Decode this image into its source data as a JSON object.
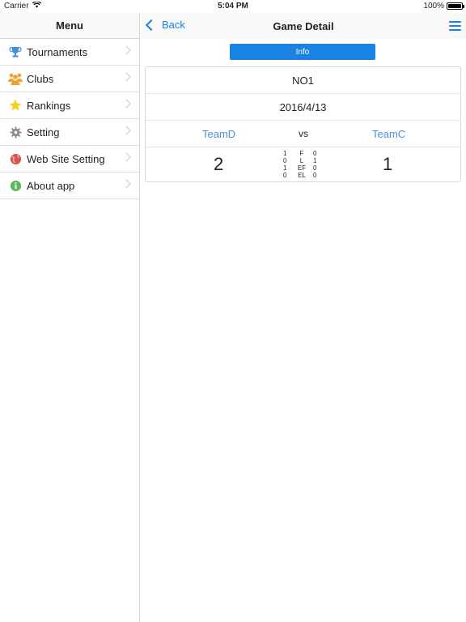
{
  "status_bar": {
    "carrier": "Carrier",
    "time": "5:04 PM",
    "battery": "100%"
  },
  "sidebar": {
    "title": "Menu",
    "items": [
      {
        "label": "Tournaments",
        "icon": "trophy-icon",
        "color": "#3d8fe0"
      },
      {
        "label": "Clubs",
        "icon": "people-icon",
        "color": "#f0a030"
      },
      {
        "label": "Rankings",
        "icon": "star-icon",
        "color": "#f2d21b"
      },
      {
        "label": "Setting",
        "icon": "gear-icon",
        "color": "#888888"
      },
      {
        "label": "Web Site Setting",
        "icon": "globe-icon",
        "color": "#d9534f"
      },
      {
        "label": "About app",
        "icon": "info-icon",
        "color": "#5cb85c"
      }
    ]
  },
  "navbar": {
    "back_label": "Back",
    "title": "Game Detail"
  },
  "tabs": {
    "info_label": "Info"
  },
  "game": {
    "number": "NO1",
    "date": "2016/4/13",
    "team_left": "TeamD",
    "vs": "vs",
    "team_right": "TeamC",
    "score_left": "2",
    "score_right": "1",
    "stats": [
      {
        "left": "1",
        "key": "F",
        "right": "0"
      },
      {
        "left": "0",
        "key": "L",
        "right": "1"
      },
      {
        "left": "1",
        "key": "EF",
        "right": "0"
      },
      {
        "left": "0",
        "key": "EL",
        "right": "0"
      }
    ]
  },
  "colors": {
    "accent": "#1a82e2",
    "team_link": "#4a90d9"
  }
}
